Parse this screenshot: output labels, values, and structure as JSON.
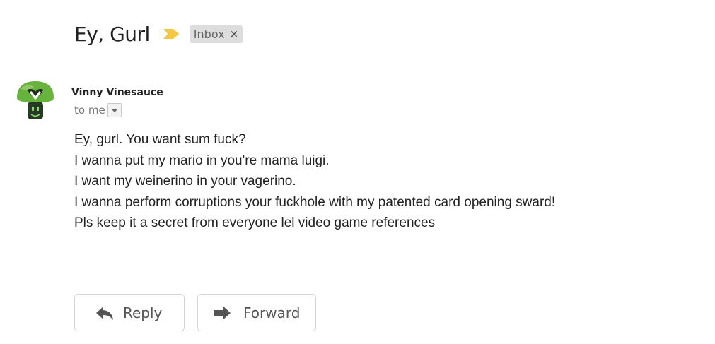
{
  "email": {
    "subject": "Ey, Gurl",
    "importance_icon": "importance-marker-icon",
    "label": {
      "text": "Inbox",
      "remove_glyph": "×"
    },
    "sender": {
      "name": "Vinny Vinesauce",
      "avatar_icon": "vinesauce-mushroom-avatar"
    },
    "recipient": "to me",
    "body_lines": [
      "Ey, gurl. You want sum fuck?",
      "I wanna put my mario in you're mama luigi.",
      "I want my weinerino in your vagerino.",
      "I wanna perform corruptions your fuckhole with my patented card opening sward!",
      "Pls keep it a secret from everyone lel video game references"
    ]
  },
  "actions": {
    "reply_label": "Reply",
    "reply_icon": "reply-arrow-icon",
    "forward_label": "Forward",
    "forward_icon": "forward-arrow-icon"
  },
  "colors": {
    "importance": "#f4c845",
    "chip_background": "#dddddd",
    "avatar_green": "#66b43c",
    "text": "#222222",
    "muted_text": "#777777"
  }
}
